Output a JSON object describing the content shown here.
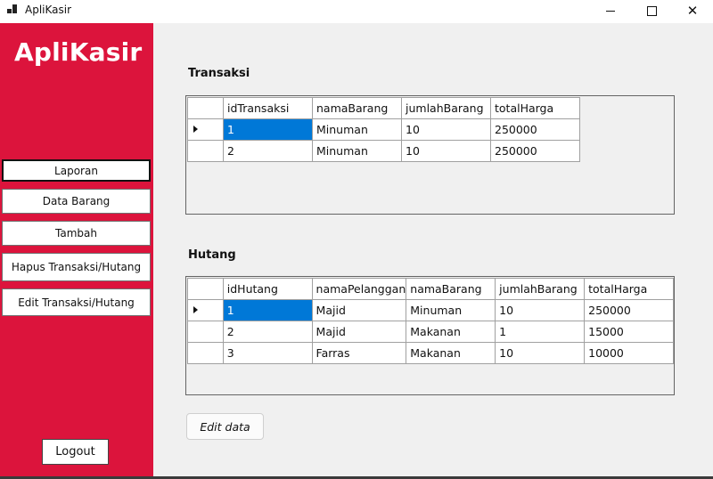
{
  "window": {
    "title": "ApliKasir"
  },
  "sidebar": {
    "brand": "ApliKasir",
    "items": [
      {
        "label": "Laporan"
      },
      {
        "label": "Data Barang"
      },
      {
        "label": "Tambah"
      },
      {
        "label": "Hapus Transaksi/Hutang"
      },
      {
        "label": "Edit Transaksi/Hutang"
      }
    ],
    "logout_label": "Logout",
    "background_color": "#dc143c"
  },
  "transaksi": {
    "title": "Transaksi",
    "columns": [
      "idTransaksi",
      "namaBarang",
      "jumlahBarang",
      "totalHarga"
    ],
    "rows": [
      [
        "1",
        "Minuman",
        "10",
        "250000"
      ],
      [
        "2",
        "Minuman",
        "10",
        "250000"
      ]
    ]
  },
  "hutang": {
    "title": "Hutang",
    "columns": [
      "idHutang",
      "namaPelanggan",
      "namaBarang",
      "jumlahBarang",
      "totalHarga"
    ],
    "rows": [
      [
        "1",
        "Majid",
        "Minuman",
        "10",
        "250000"
      ],
      [
        "2",
        "Majid",
        "Makanan",
        "1",
        "15000"
      ],
      [
        "3",
        "Farras",
        "Makanan",
        "10",
        "10000"
      ]
    ]
  },
  "edit_button_label": "Edit data",
  "selection_color": "#0078d7"
}
